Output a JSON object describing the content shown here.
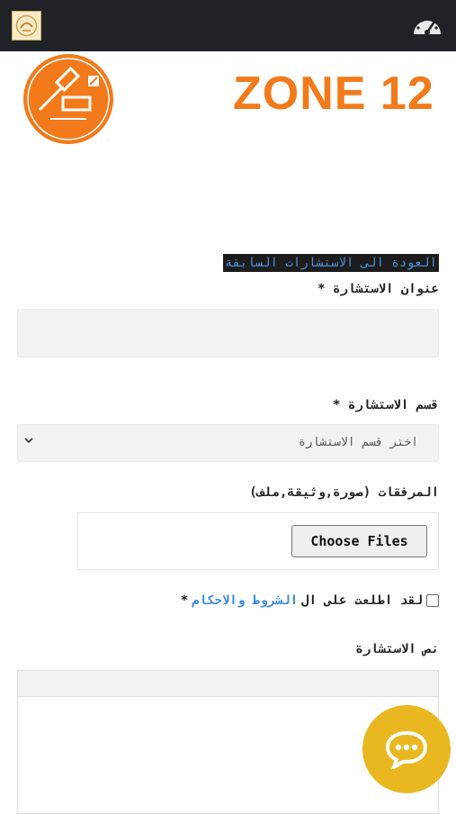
{
  "brand": {
    "zone_logo_text": "ZONE 12",
    "colors": {
      "accent": "#f27a1a",
      "topbar": "#1f2327",
      "chat": "#e9b821",
      "link": "#3a8ad8"
    }
  },
  "header": {
    "icons": [
      "app-logo-icon",
      "dashboard-icon"
    ]
  },
  "form": {
    "back_link": "العودة الى الاستشارات السابقة",
    "title_label": "عنوان الاستشارة *",
    "title_value": "",
    "category_label": "قسم الاستشارة *",
    "category_selected": "اختر قسم الاستشارة",
    "attachments_label": "المرفقات (صورة,وثيقة,ملف)",
    "file_button": "Choose Files",
    "terms_prefix": "لقد اطلعت على ال",
    "terms_link": "الشروط والاحكام",
    "terms_required": "*",
    "body_label": "نص الاستشارة",
    "body_value": ""
  },
  "chat": {
    "icon": "chat-bubble-icon"
  }
}
